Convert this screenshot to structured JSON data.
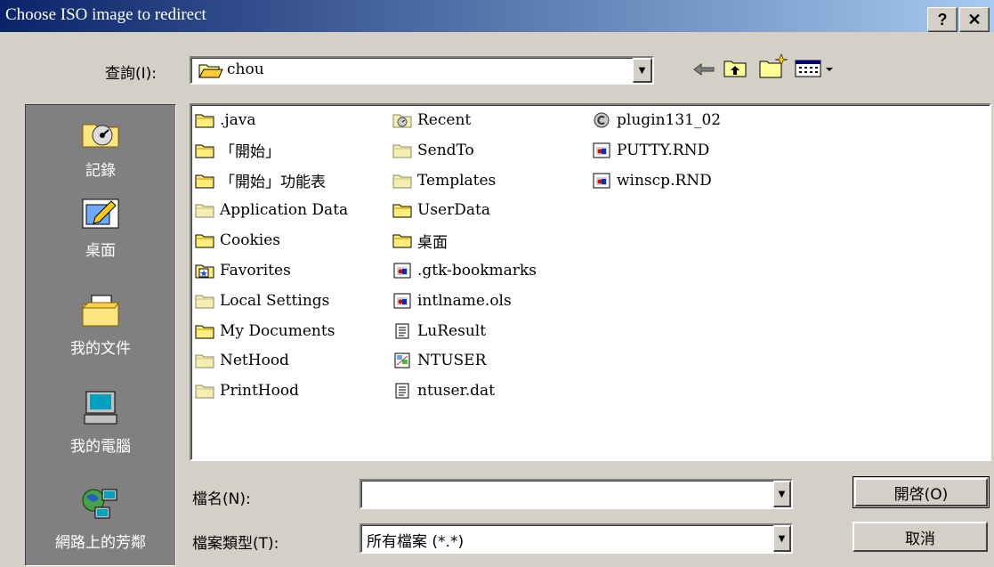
{
  "window": {
    "title": "Choose ISO image to redirect",
    "help_label": "?",
    "close_label": "✕"
  },
  "toolbar": {
    "look_in_label": "查詢(I):",
    "look_in_value": "chou",
    "back_icon": "back-arrow-icon",
    "up_icon": "up-folder-icon",
    "new_folder_icon": "new-folder-icon",
    "view_menu_icon": "view-menu-icon"
  },
  "places": [
    {
      "label": "記錄",
      "icon": "history-icon"
    },
    {
      "label": "桌面",
      "icon": "desktop-icon"
    },
    {
      "label": "我的文件",
      "icon": "my-documents-icon"
    },
    {
      "label": "我的電腦",
      "icon": "my-computer-icon"
    },
    {
      "label": "網路上的芳鄰",
      "icon": "network-places-icon"
    }
  ],
  "files": {
    "col1": [
      {
        "name": ".java",
        "type": "folder"
      },
      {
        "name": "「開始」",
        "type": "folder"
      },
      {
        "name": "「開始」功能表",
        "type": "folder"
      },
      {
        "name": "Application Data",
        "type": "folder-light"
      },
      {
        "name": "Cookies",
        "type": "folder"
      },
      {
        "name": "Favorites",
        "type": "favorites"
      },
      {
        "name": "Local Settings",
        "type": "folder-light"
      },
      {
        "name": "My Documents",
        "type": "folder"
      },
      {
        "name": "NetHood",
        "type": "folder-light"
      },
      {
        "name": "PrintHood",
        "type": "folder-light"
      }
    ],
    "col2": [
      {
        "name": "Recent",
        "type": "recent"
      },
      {
        "name": "SendTo",
        "type": "folder-light"
      },
      {
        "name": "Templates",
        "type": "folder-light"
      },
      {
        "name": "UserData",
        "type": "folder"
      },
      {
        "name": "桌面",
        "type": "folder"
      },
      {
        "name": ".gtk-bookmarks",
        "type": "file-media"
      },
      {
        "name": "intlname.ols",
        "type": "file-media"
      },
      {
        "name": "LuResult",
        "type": "notepad"
      },
      {
        "name": "NTUSER",
        "type": "registry"
      },
      {
        "name": "ntuser.dat",
        "type": "notepad"
      }
    ],
    "col3": [
      {
        "name": "plugin131_02",
        "type": "plugin"
      },
      {
        "name": "PUTTY.RND",
        "type": "file-media"
      },
      {
        "name": "winscp.RND",
        "type": "file-media"
      }
    ]
  },
  "filename": {
    "label": "檔名(N):",
    "value": ""
  },
  "filetype": {
    "label": "檔案類型(T):",
    "value": "所有檔案 (*.*)"
  },
  "buttons": {
    "open": "開啓(O)",
    "cancel": "取消"
  }
}
